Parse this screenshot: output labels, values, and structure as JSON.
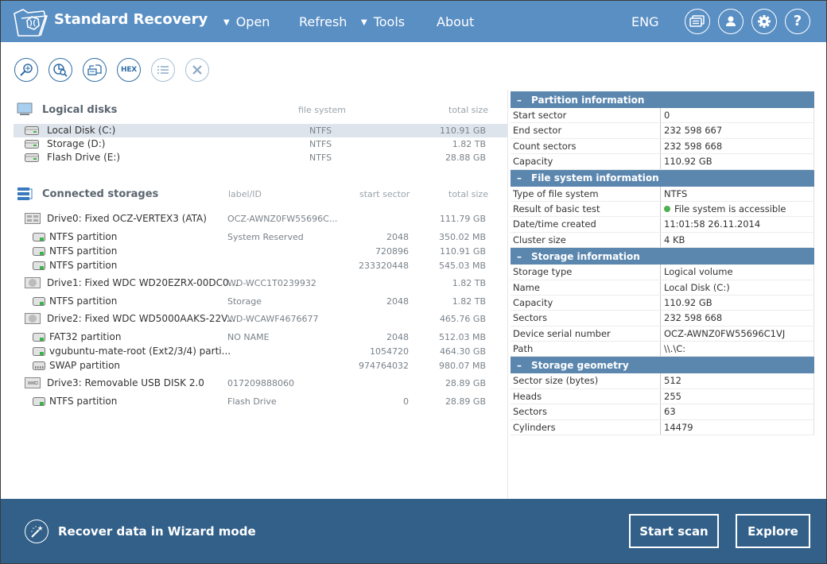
{
  "header": {
    "app_title": "Standard Recovery",
    "menu": [
      {
        "label": "Open",
        "has_caret": true
      },
      {
        "label": "Refresh",
        "has_caret": false
      },
      {
        "label": "Tools",
        "has_caret": true
      },
      {
        "label": "About",
        "has_caret": false
      }
    ],
    "language": "ENG",
    "icons": [
      "windows-icon",
      "user-icon",
      "settings-icon",
      "help-icon"
    ]
  },
  "toolbar": {
    "buttons": [
      {
        "icon": "search-icon",
        "enabled": true
      },
      {
        "icon": "partition-search-icon",
        "enabled": true
      },
      {
        "icon": "image-create-icon",
        "enabled": true
      },
      {
        "label": "HEX",
        "icon": "hex-icon",
        "enabled": true
      },
      {
        "icon": "list-icon",
        "enabled": false
      },
      {
        "icon": "close-icon",
        "enabled": false
      }
    ]
  },
  "logical_disks": {
    "title": "Logical disks",
    "columns": {
      "file_system": "file system",
      "total_size": "total size"
    },
    "items": [
      {
        "name": "Local Disk (C:)",
        "file_system": "NTFS",
        "total_size": "110.91 GB",
        "selected": true
      },
      {
        "name": "Storage (D:)",
        "file_system": "NTFS",
        "total_size": "1.82 TB",
        "selected": false
      },
      {
        "name": "Flash Drive (E:)",
        "file_system": "NTFS",
        "total_size": "28.88 GB",
        "selected": false
      }
    ]
  },
  "connected_storages": {
    "title": "Connected storages",
    "columns": {
      "label_id": "label/ID",
      "start_sector": "start sector",
      "total_size": "total size"
    },
    "rows": [
      {
        "type": "drive",
        "icon": "ssd-drive-icon",
        "name": "Drive0: Fixed OCZ-VERTEX3 (ATA)",
        "label": "OCZ-AWNZ0FW55696C...",
        "start": "",
        "size": "111.79 GB"
      },
      {
        "type": "partition",
        "icon": "partition-icon",
        "name": "NTFS partition",
        "label": "System Reserved",
        "start": "2048",
        "size": "350.02 MB"
      },
      {
        "type": "partition",
        "icon": "partition-icon",
        "name": "NTFS partition",
        "label": "",
        "start": "720896",
        "size": "110.91 GB"
      },
      {
        "type": "partition",
        "icon": "partition-icon",
        "name": "NTFS partition",
        "label": "",
        "start": "233320448",
        "size": "545.03 MB"
      },
      {
        "type": "drive",
        "icon": "hdd-drive-icon",
        "name": "Drive1: Fixed WDC WD20EZRX-00DC0...",
        "label": "WD-WCC1T0239932",
        "start": "",
        "size": "1.82 TB"
      },
      {
        "type": "partition",
        "icon": "partition-icon",
        "name": "NTFS partition",
        "label": "Storage",
        "start": "2048",
        "size": "1.82 TB"
      },
      {
        "type": "drive",
        "icon": "hdd-drive-icon",
        "name": "Drive2: Fixed WDC WD5000AAKS-22V...",
        "label": "WD-WCAWF4676677",
        "start": "",
        "size": "465.76 GB"
      },
      {
        "type": "partition",
        "icon": "partition-icon",
        "name": "FAT32 partition",
        "label": "NO NAME",
        "start": "2048",
        "size": "512.03 MB"
      },
      {
        "type": "partition",
        "icon": "partition-icon",
        "name": "vgubuntu-mate-root (Ext2/3/4) parti...",
        "label": "",
        "start": "1054720",
        "size": "464.30 GB"
      },
      {
        "type": "partition",
        "icon": "swap-partition-icon",
        "name": "SWAP partition",
        "label": "",
        "start": "974764032",
        "size": "980.07 MB"
      },
      {
        "type": "drive",
        "icon": "usb-drive-icon",
        "name": "Drive3: Removable USB DISK 2.0",
        "label": "017209888060",
        "start": "",
        "size": "28.89 GB"
      },
      {
        "type": "partition",
        "icon": "partition-icon",
        "name": "NTFS partition",
        "label": "Flash Drive",
        "start": "0",
        "size": "28.89 GB"
      }
    ]
  },
  "properties": {
    "groups": [
      {
        "title": "Partition information",
        "rows": [
          {
            "k": "Start sector",
            "v": "0"
          },
          {
            "k": "End sector",
            "v": "232 598 667"
          },
          {
            "k": "Count sectors",
            "v": "232 598 668"
          },
          {
            "k": "Capacity",
            "v": "110.92 GB"
          }
        ]
      },
      {
        "title": "File system information",
        "rows": [
          {
            "k": "Type of file system",
            "v": "NTFS"
          },
          {
            "k": "Result of basic test",
            "v": "File system is accessible",
            "status": "ok"
          },
          {
            "k": "Date/time created",
            "v": "11:01:58 26.11.2014"
          },
          {
            "k": "Cluster size",
            "v": "4 KB"
          }
        ]
      },
      {
        "title": "Storage information",
        "rows": [
          {
            "k": "Storage type",
            "v": "Logical volume"
          },
          {
            "k": "Name",
            "v": "Local Disk (C:)"
          },
          {
            "k": "Capacity",
            "v": "110.92 GB"
          },
          {
            "k": "Sectors",
            "v": "232 598 668"
          },
          {
            "k": "Device serial number",
            "v": "OCZ-AWNZ0FW55696C1VJ"
          },
          {
            "k": "Path",
            "v": "\\\\.\\C:"
          }
        ]
      },
      {
        "title": "Storage geometry",
        "rows": [
          {
            "k": "Sector size (bytes)",
            "v": "512"
          },
          {
            "k": "Heads",
            "v": "255"
          },
          {
            "k": "Sectors",
            "v": "63"
          },
          {
            "k": "Cylinders",
            "v": "14479"
          }
        ]
      }
    ],
    "collapse_symbol": "–",
    "status_ok_color": "#4caf50"
  },
  "footer": {
    "wizard_label": "Recover data in Wizard mode",
    "start_scan_label": "Start scan",
    "explore_label": "Explore"
  },
  "colors": {
    "header_bg": "#5a8fc4",
    "footer_bg": "#326089",
    "group_header_bg": "#5b87af",
    "selection_bg": "#dde4ec"
  }
}
